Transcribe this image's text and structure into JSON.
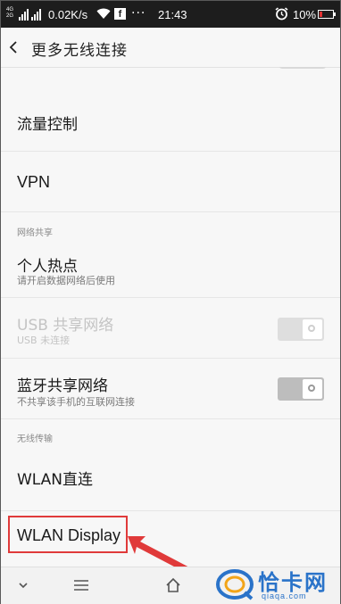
{
  "status_bar": {
    "network_type_top": "4G",
    "network_type_bottom": "2G",
    "speed": "0.02K/s",
    "more_icons": "···",
    "time": "21:43",
    "battery_percent": "10%",
    "icons": [
      "signal-icon",
      "wifi-icon",
      "facebook-icon",
      "alarm-icon",
      "battery-icon"
    ]
  },
  "header": {
    "back_icon": "‹",
    "title": "更多无线连接"
  },
  "list": {
    "traffic_control": "流量控制",
    "vpn": "VPN",
    "section_network_sharing": "网络共享",
    "hotspot_title": "个人热点",
    "hotspot_subtitle": "请开启数据网络后使用",
    "usb_title": "USB 共享网络",
    "usb_subtitle": "USB 未连接",
    "bluetooth_title": "蓝牙共享网络",
    "bluetooth_subtitle": "不共享该手机的互联网连接",
    "section_wireless_transfer": "无线传输",
    "wlan_direct": "WLAN直连",
    "wlan_display": "WLAN Display"
  },
  "toggles": {
    "usb_enabled": false,
    "bluetooth_enabled": false
  },
  "nav": {
    "icons": [
      "chevron-down-icon",
      "menu-icon",
      "home-icon"
    ]
  },
  "watermark": {
    "text": "恰卡网",
    "url": "qiaqa.com"
  },
  "colors": {
    "status_bar": "#1d1d1d",
    "highlight": "#e03a3a",
    "watermark": "#2a73c9"
  }
}
